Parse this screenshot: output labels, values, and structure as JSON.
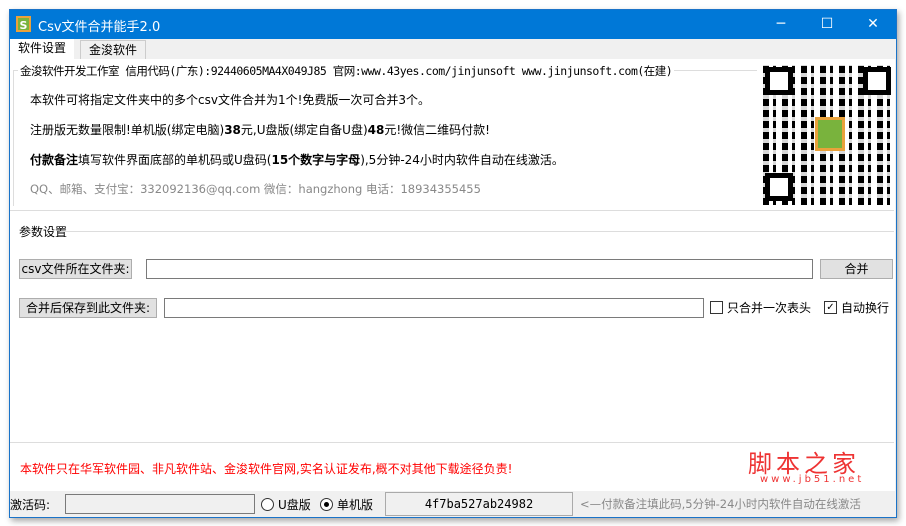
{
  "window": {
    "title": "Csv文件合并能手2.0",
    "logo": "S",
    "minimize": "─",
    "maximize": "☐",
    "close": "✕"
  },
  "tabs": [
    "软件设置",
    "金浚软件"
  ],
  "info": {
    "group_label": "金浚软件开发工作室 信用代码(广东):92440605MA4X049J85 官网:www.43yes.com/jinjunsoft  www.jinjunsoft.com(在建)",
    "line1": "本软件可将指定文件夹中的多个csv文件合并为1个!免费版一次可合并3个。",
    "line2_a": "注册版无数量限制!单机版(绑定电脑)",
    "line2_b": "38",
    "line2_c": "元,U盘版(绑定自备U盘)",
    "line2_d": "48",
    "line2_e": "元!微信二维码付款!",
    "line3_a": "付款备注",
    "line3_b": "填写软件界面底部的单机码或U盘码(",
    "line3_c": "15个数字与字母",
    "line3_d": "),5分钟-24小时内软件自动在线激活。",
    "contact": "QQ、邮箱、支付宝：332092136@qq.com   微信：hangzhong   电话：18934355455"
  },
  "params": {
    "label": "参数设置",
    "csv_folder_btn": "csv文件所在文件夹:",
    "csv_folder_value": "",
    "merge_btn": "合并",
    "save_folder_btn": "合并后保存到此文件夹:",
    "save_folder_value": "",
    "only_header_once": "只合并一次表头",
    "only_header_checked": false,
    "auto_wrap": "自动换行",
    "auto_wrap_checked": true,
    "check_mark": "✓"
  },
  "notice": "本软件只在华军软件园、非凡软件站、金浚软件官网,实名认证发布,概不对其他下载途径负责!",
  "watermark": {
    "title": "脚本之家",
    "url": "www.jb51.net"
  },
  "bottom": {
    "activation_label": "激活码:",
    "activation_value": "",
    "usb": "U盘版",
    "single": "单机版",
    "selected": "单机版",
    "machine_code": "4f7ba527ab24982",
    "hint": "<—付款备注填此码,5分钟-24小时内软件自动在线激活"
  },
  "colors": {
    "title_bar": "#0078d7",
    "notice": "#ff0000"
  }
}
